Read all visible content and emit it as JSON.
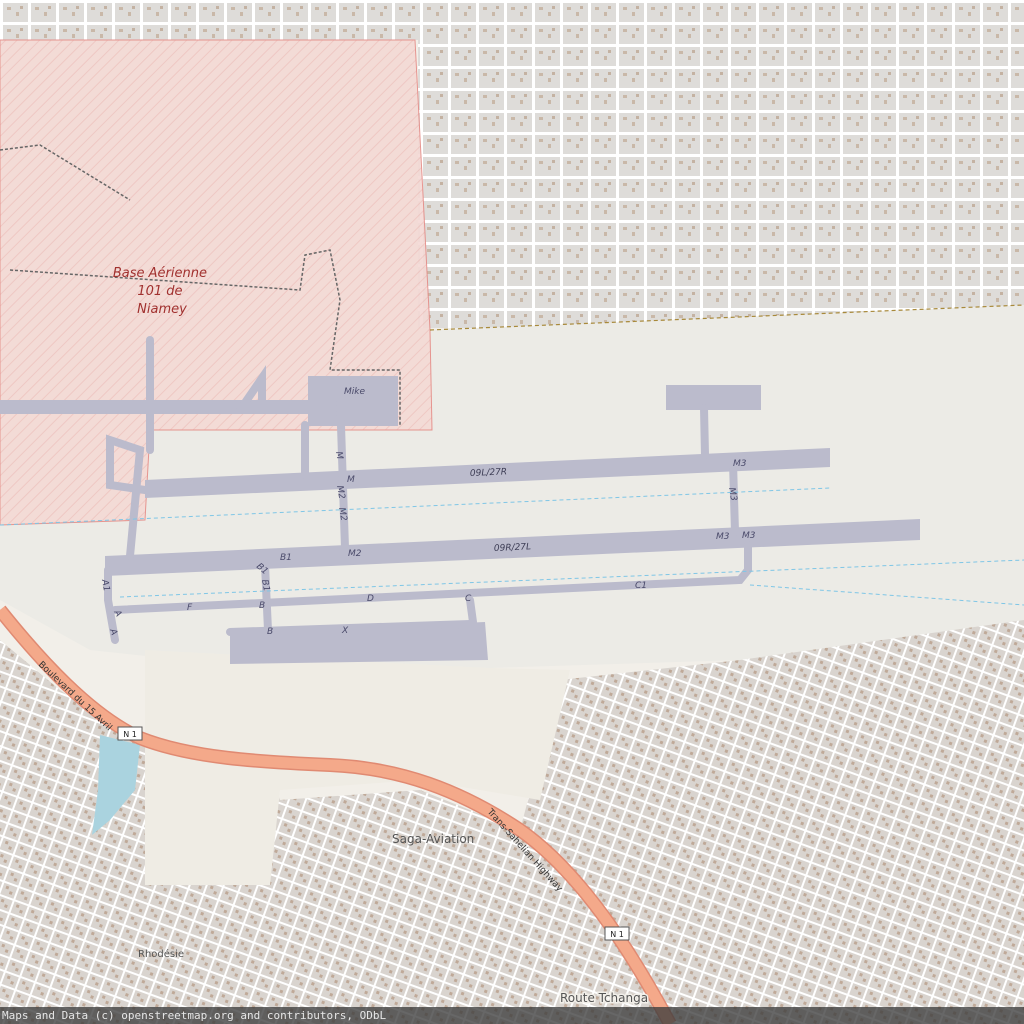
{
  "map": {
    "military_area": [
      "Base Aérienne",
      "101 de",
      "Niamey"
    ],
    "apron_label": "Mike",
    "runways": [
      "09L/27R",
      "09R/27L"
    ],
    "taxiways": [
      "M",
      "M2",
      "M2",
      "M2",
      "M",
      "B1",
      "B1",
      "B1",
      "B",
      "B",
      "F",
      "D",
      "X",
      "C",
      "C1",
      "A1",
      "A",
      "A",
      "M3",
      "M3",
      "M3",
      "M3"
    ],
    "places": {
      "saga": "Saga-Aviation",
      "rhodesie": "Rhodésie",
      "route": "Route Tchanga"
    },
    "roads": {
      "boulevard": "Boulevard du 15 Avril",
      "highway": "Trans-Sahelian Highway"
    },
    "shields": [
      "N 1",
      "N 1"
    ],
    "colors": {
      "military": "#f4d6d2",
      "runway": "#bbbbcc",
      "urban": "#dedcd9",
      "highway": "#f4a98a",
      "water": "#aad3df",
      "land": "#f2efe9"
    }
  },
  "attribution": "Maps and Data (c) openstreetmap.org and contributors, ODbL"
}
